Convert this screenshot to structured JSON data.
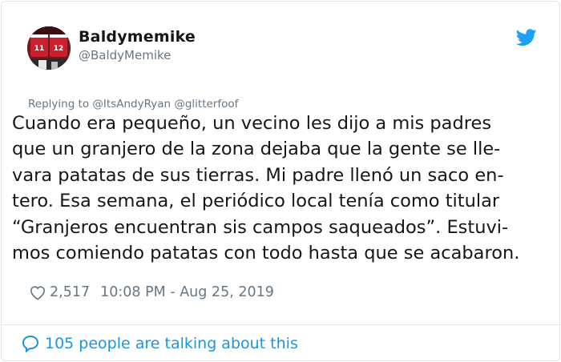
{
  "tweet": {
    "display_name": "Baldymemike",
    "handle": "@BaldyMemike",
    "replying_prefix": "Replying to",
    "replying_to": [
      "@ItsAndyRyan",
      "@glitterfoof"
    ],
    "text_lines": [
      "Cuando era pequeño, un vecino les dijo a mis padres",
      "que un granjero de la zona dejaba que la gente se lle-",
      "vara patatas de sus tierras. Mi padre llenó un saco en-",
      "tero. Esa semana, el periódico local tenía como titular",
      "“Granjeros encuentran sis campos saqueados”. Estuvi-",
      "mos comiendo patatas con todo hasta que se acabaron."
    ],
    "likes": "2,517",
    "timestamp": "10:08 PM - Aug 25, 2019",
    "talking_text": "105 people are talking about this",
    "avatar_numbers": [
      "11",
      "12"
    ]
  },
  "colors": {
    "accent": "#1da1f2",
    "link": "#1b95e0",
    "muted": "#657786",
    "text": "#14171a",
    "border": "#e1e8ed",
    "avatar_red": "#8a1c24"
  },
  "icons": {
    "brand": "twitter-bird-icon",
    "like": "heart-icon",
    "conversation": "speech-bubble-icon"
  }
}
